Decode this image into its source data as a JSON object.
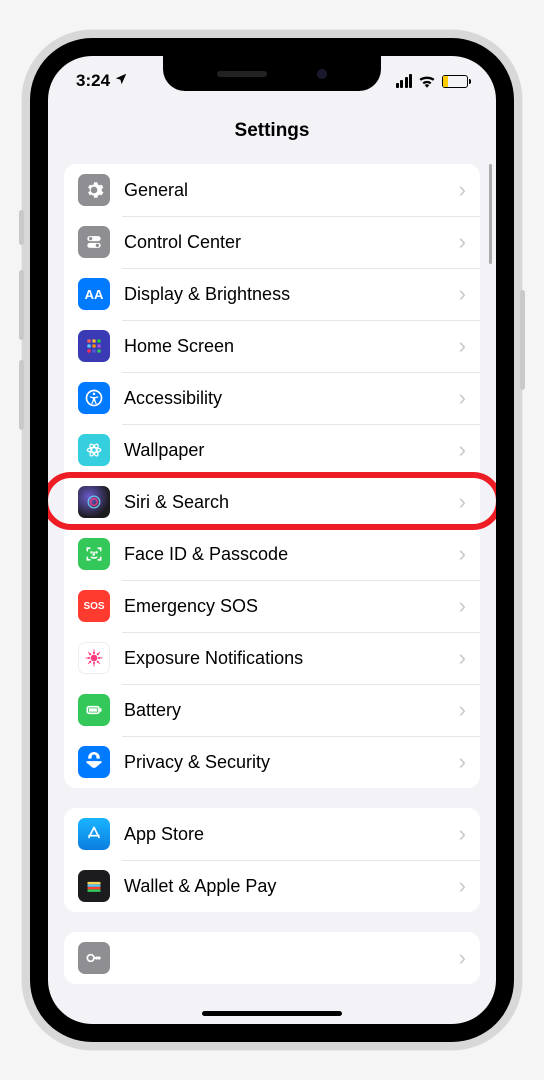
{
  "status": {
    "time": "3:24",
    "location_icon": "➤"
  },
  "header": {
    "title": "Settings"
  },
  "groups": [
    {
      "id": "main",
      "items": [
        {
          "id": "general",
          "label": "General",
          "icon": "gear",
          "color": "#8e8e93"
        },
        {
          "id": "control-center",
          "label": "Control Center",
          "icon": "switches",
          "color": "#8e8e93"
        },
        {
          "id": "display",
          "label": "Display & Brightness",
          "icon": "AA",
          "color": "#007aff"
        },
        {
          "id": "home-screen",
          "label": "Home Screen",
          "icon": "home-grid",
          "color": "#3e4db5"
        },
        {
          "id": "accessibility",
          "label": "Accessibility",
          "icon": "accessibility",
          "color": "#007aff"
        },
        {
          "id": "wallpaper",
          "label": "Wallpaper",
          "icon": "flower",
          "color": "#36cfe0"
        },
        {
          "id": "siri",
          "label": "Siri & Search",
          "icon": "siri-orb",
          "color": "#1c1c1e",
          "highlighted": true
        },
        {
          "id": "faceid",
          "label": "Face ID & Passcode",
          "icon": "faceid",
          "color": "#34c759"
        },
        {
          "id": "sos",
          "label": "Emergency SOS",
          "icon": "SOS",
          "color": "#ff3b30"
        },
        {
          "id": "exposure",
          "label": "Exposure Notifications",
          "icon": "exposure",
          "color": "#ffffff"
        },
        {
          "id": "battery",
          "label": "Battery",
          "icon": "battery",
          "color": "#34c759"
        },
        {
          "id": "privacy",
          "label": "Privacy & Security",
          "icon": "hand",
          "color": "#007aff"
        }
      ]
    },
    {
      "id": "store",
      "items": [
        {
          "id": "appstore",
          "label": "App Store",
          "icon": "appstore",
          "color": "#1a9ff0"
        },
        {
          "id": "wallet",
          "label": "Wallet & Apple Pay",
          "icon": "wallet",
          "color": "#1c1c1e"
        }
      ]
    },
    {
      "id": "cutoff",
      "items": [
        {
          "id": "passwords",
          "label": "",
          "icon": "key",
          "color": "#8e8e93"
        }
      ]
    }
  ]
}
